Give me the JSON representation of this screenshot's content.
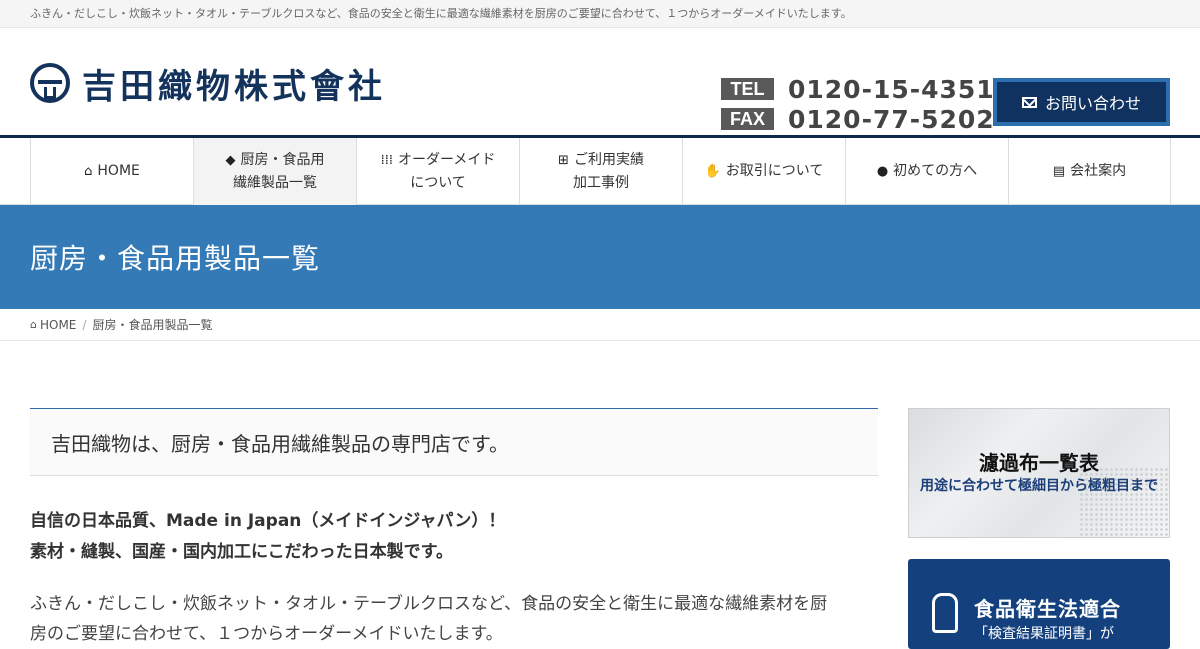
{
  "topbar": {
    "tagline": "ふきん・だしこし・炊飯ネット・タオル・テーブルクロスなど、食品の安全と衛生に最適な繊維素材を厨房のご要望に合わせて、１つからオーダーメイドいたします。"
  },
  "header": {
    "logo_text": "吉田織物株式會社",
    "tel_label": "TEL",
    "tel_number": "0120-15-4351",
    "fax_label": "FAX",
    "fax_number": "0120-77-5202",
    "inquiry_label": "お問い合わせ"
  },
  "nav": {
    "items": [
      {
        "icon": "home-icon",
        "line1": "HOME",
        "line2": ""
      },
      {
        "icon": "tags-icon",
        "line1": "厨房・食品用",
        "line2": "繊維製品一覧"
      },
      {
        "icon": "grid-icon",
        "line1": "オーダーメイド",
        "line2": "について"
      },
      {
        "icon": "sitemap-icon",
        "line1": "ご利用実績",
        "line2": "加工事例"
      },
      {
        "icon": "handshake-icon",
        "line1": "お取引について",
        "line2": ""
      },
      {
        "icon": "info-icon",
        "line1": "初めての方へ",
        "line2": ""
      },
      {
        "icon": "building-icon",
        "line1": "会社案内",
        "line2": ""
      }
    ],
    "active_index": 1
  },
  "banner": {
    "title": "厨房・食品用製品一覧"
  },
  "breadcrumb": {
    "home": "HOME",
    "current": "厨房・食品用製品一覧"
  },
  "main": {
    "lead": "吉田織物は、厨房・食品用繊維製品の専門店です。",
    "strong_line1": "自信の日本品質、Made in Japan（メイドインジャパン）！",
    "strong_line2": "素材・縫製、国産・国内加工にこだわった日本製です。",
    "body_line1": "ふきん・だしこし・炊飯ネット・タオル・テーブルクロスなど、食品の安全と衛生に最適な繊維素材を厨",
    "body_line2": "房のご要望に合わせて、１つからオーダーメイドいたします。"
  },
  "sidebar": {
    "banner1_title": "濾過布一覧表",
    "banner1_sub": "用途に合わせて極細目から極粗目まで",
    "banner2_title": "食品衛生法適合",
    "banner2_sub": "「検査結果証明書」が"
  },
  "colors": {
    "brand_navy": "#14335c",
    "banner_blue": "#337ab7",
    "button_navy": "#0f3260"
  }
}
